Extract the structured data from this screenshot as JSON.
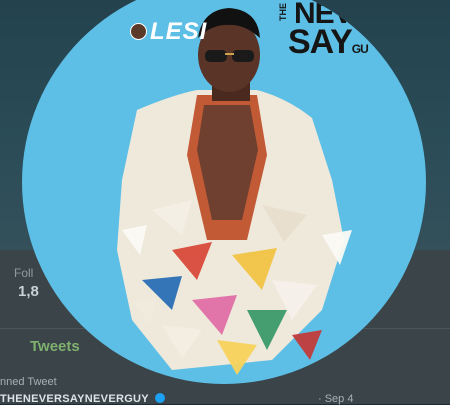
{
  "profile_background": {
    "follow_label": "Foll",
    "follow_value": "1,8",
    "tab_tweets": "Tweets",
    "pinned_label": "nned Tweet",
    "pinned_author": "THENEVERSAYNEVERGUY",
    "pinned_date": "· Sep 4"
  },
  "photo": {
    "logo_left_text": "LESI",
    "logo_right_the": "THE",
    "logo_right_line1": "NEVE",
    "logo_right_line2": "SAY",
    "logo_right_suffix": "GU"
  },
  "colors": {
    "photo_background": "#5ebfe6",
    "jacket": "#efe9dc",
    "tweets_tab": "#7fb16f"
  },
  "icons": [
    "verified-badge-icon"
  ]
}
